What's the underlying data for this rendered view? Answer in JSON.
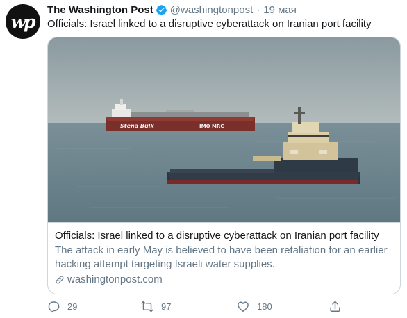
{
  "tweet": {
    "avatar_text": "wp",
    "author_name": "The Washington Post",
    "handle": "@washingtonpost",
    "separator": "·",
    "time": "19 мая",
    "text": "Officials: Israel linked to a disruptive cyberattack on Iranian port facility"
  },
  "card": {
    "title": "Officials: Israel linked to a disruptive cyberattack on Iranian port facility",
    "description": "The attack in early May is believed to have been retaliation for an earlier hacking attempt targeting Israeli water supplies.",
    "link": "washingtonpost.com",
    "ship_labels": {
      "stena_bulk": "Stena Bulk",
      "imo_mrc": "IMO MRC"
    }
  },
  "actions": {
    "replies": "29",
    "retweets": "97",
    "likes": "180"
  },
  "colors": {
    "verified": "#1da1f2",
    "muted_text": "#657786",
    "primary_text": "#14171a",
    "border": "#ccd6dd"
  }
}
